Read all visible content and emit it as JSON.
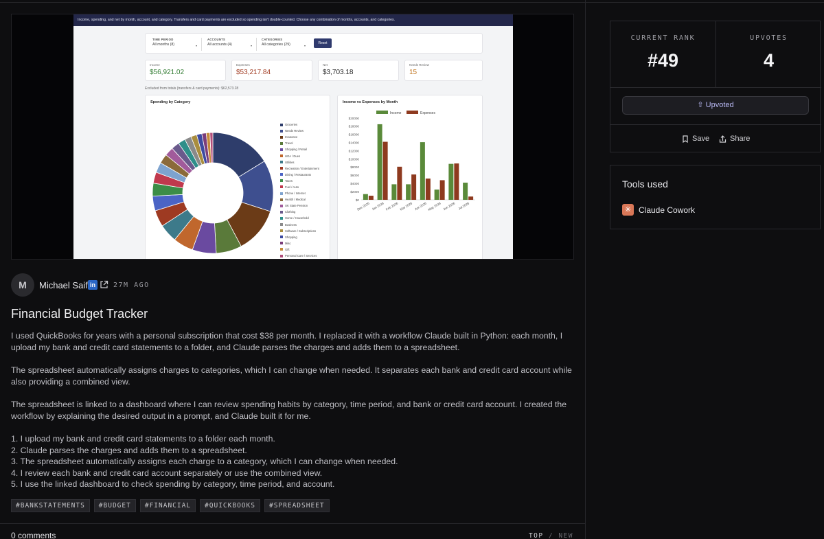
{
  "preview": {
    "banner": "Income, spending, and net by month, account, and category. Transfers and card payments are excluded so spending isn't double-counted. Choose any combination of months, accounts, and categories.",
    "filters": [
      {
        "label": "TIME PERIOD",
        "value": "All months (8)"
      },
      {
        "label": "ACCOUNTS",
        "value": "All accounts (4)"
      },
      {
        "label": "CATEGORIES",
        "value": "All categories (29)"
      }
    ],
    "reset_label": "Reset",
    "kpis": [
      {
        "label": "Income",
        "value": "$56,921.02",
        "color": "#2f7a2f"
      },
      {
        "label": "Expenses",
        "value": "$53,217.84",
        "color": "#a0391f"
      },
      {
        "label": "Net",
        "value": "$3,703.18",
        "color": "#222222"
      },
      {
        "label": "Needs Review",
        "value": "15",
        "color": "#c0741d"
      }
    ],
    "excluded_note": "Excluded from totals (transfers & card payments): $62,573.28",
    "charts": {
      "chart_data": [
        {
          "type": "pie",
          "title": "Spending by Category",
          "categories": [
            "Groceries",
            "Needs Review",
            "Insurance",
            "Travel",
            "Shopping / Retail",
            "HOA / Dues",
            "Utilities",
            "Recreation / Entertainment",
            "Dining / Restaurants",
            "Taxes",
            "Fuel / Auto",
            "Phone / Internet",
            "Health / Medical",
            "UK State Pension",
            "Clothing",
            "Home / Household",
            "Business",
            "Software / Subscriptions",
            "Shopping",
            "Misc",
            "Gift",
            "Personal Care / Services"
          ],
          "values": [
            16.5,
            14,
            12.5,
            7,
            6.5,
            5.5,
            5,
            4.5,
            4,
            3.5,
            3,
            2.8,
            2.6,
            2.4,
            2.2,
            2.0,
            1.8,
            1.6,
            1.4,
            1.2,
            1.0,
            0.8
          ],
          "colors": [
            "#2e3d6b",
            "#3e4f8f",
            "#6b3b17",
            "#5a7a3a",
            "#6a4aa0",
            "#c0672d",
            "#3d7a8a",
            "#9e3a22",
            "#4b64c5",
            "#3c8d47",
            "#c0394d",
            "#7ea3cf",
            "#8b6a3a",
            "#a15b9b",
            "#6a5a8c",
            "#2f8f8a",
            "#8a8a8a",
            "#a98d3e",
            "#3d4aa0",
            "#7b3d7b",
            "#c58a3a",
            "#b04e7a"
          ]
        },
        {
          "type": "bar",
          "title": "Income vs Expenses by Month",
          "categories": [
            "Dec 2025",
            "Jan 2026",
            "Feb 2026",
            "Mar 2026",
            "Apr 2026",
            "May 2026",
            "Jun 2026",
            "Jul 2026"
          ],
          "series": [
            {
              "name": "Income",
              "values": [
                1400,
                18500,
                3800,
                3800,
                14100,
                2500,
                8800,
                4200
              ],
              "color": "#5a8a3a"
            },
            {
              "name": "Expenses",
              "values": [
                1000,
                14200,
                8100,
                6200,
                5200,
                4800,
                8900,
                800
              ],
              "color": "#8e3a1f"
            }
          ],
          "ylim": [
            0,
            20000
          ],
          "yticks": [
            "$0",
            "$2000",
            "$4000",
            "$6000",
            "$8000",
            "$10000",
            "$12000",
            "$14000",
            "$16000",
            "$18000",
            "$20000"
          ],
          "grid": false,
          "legend": "top-center"
        }
      ]
    }
  },
  "author": {
    "initial": "M",
    "name": "Michael Saif",
    "linkedin": "in",
    "time": "27M AGO"
  },
  "post": {
    "title": "Financial Budget Tracker",
    "paragraphs": [
      "I used QuickBooks for years with a personal subscription that cost $38 per month. I replaced it with a workflow Claude built in Python: each month, I upload my bank and credit card statements to a folder, and Claude parses the charges and adds them to a spreadsheet.",
      "The spreadsheet automatically assigns charges to categories, which I can change when needed. It separates each bank and credit card account while also providing a combined view.",
      "The spreadsheet is linked to a dashboard where I can review spending habits by category, time period, and bank or credit card account. I created the workflow by explaining the desired output in a prompt, and Claude built it for me."
    ],
    "steps": [
      "1. I upload my bank and credit card statements to a folder each month.",
      "2. Claude parses the charges and adds them to a spreadsheet.",
      "3. The spreadsheet automatically assigns each charge to a category, which I can change when needed.",
      "4. I review each bank and credit card account separately or use the combined view.",
      "5. I use the linked dashboard to check spending by category, time period, and account."
    ],
    "tags": [
      "#BANKSTATEMENTS",
      "#BUDGET",
      "#FINANCIAL",
      "#QUICKBOOKS",
      "#SPREADSHEET"
    ]
  },
  "comments": {
    "count_label": "0 comments",
    "sort_top": "TOP",
    "sort_sep": "/",
    "sort_new": "NEW"
  },
  "sidebar": {
    "rank_label": "CURRENT RANK",
    "rank_value": "#49",
    "upvotes_label": "UPVOTES",
    "upvotes_value": "4",
    "upvote_button": "Upvoted",
    "save_label": "Save",
    "share_label": "Share",
    "tools_heading": "Tools used",
    "tools": [
      {
        "name": "Claude Cowork"
      }
    ]
  }
}
